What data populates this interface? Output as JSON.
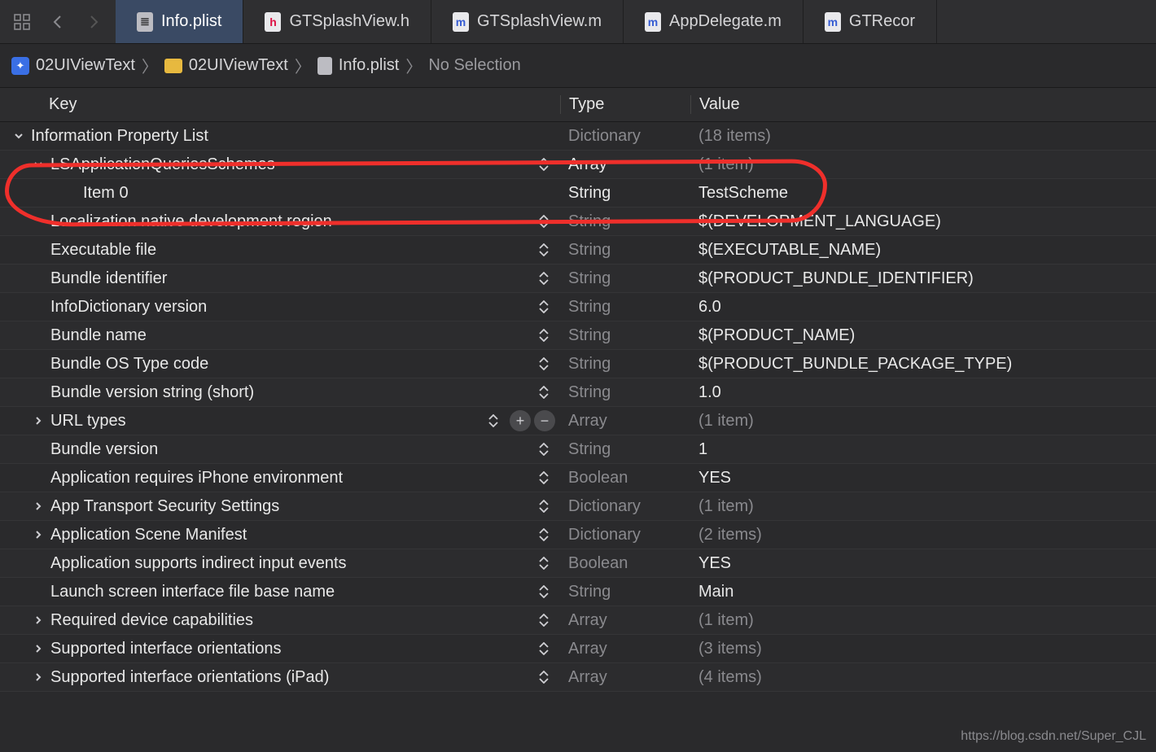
{
  "tabs": {
    "active": "Info.plist",
    "items": [
      {
        "label": "Info.plist",
        "icon": "plist"
      },
      {
        "label": "GTSplashView.h",
        "icon": "h"
      },
      {
        "label": "GTSplashView.m",
        "icon": "m"
      },
      {
        "label": "AppDelegate.m",
        "icon": "m"
      },
      {
        "label": "GTRecor",
        "icon": "m"
      }
    ]
  },
  "breadcrumb": {
    "project": "02UIViewText",
    "folder": "02UIViewText",
    "file": "Info.plist",
    "selection": "No Selection"
  },
  "columns": {
    "key": "Key",
    "type": "Type",
    "value": "Value"
  },
  "rows": [
    {
      "key": "Information Property List",
      "type": "Dictionary",
      "value": "(18 items)",
      "indent": 0,
      "disclosure": "down",
      "typeActive": false,
      "valueMuted": true,
      "stepper": false,
      "plusminus": false
    },
    {
      "key": "LSApplicationQueriesSchemes",
      "type": "Array",
      "value": "(1 item)",
      "indent": 1,
      "disclosure": "down",
      "typeActive": true,
      "valueMuted": true,
      "stepper": true,
      "plusminus": false
    },
    {
      "key": "Item 0",
      "type": "String",
      "value": "TestScheme",
      "indent": 2,
      "disclosure": "none",
      "typeActive": true,
      "valueMuted": false,
      "stepper": false,
      "plusminus": false
    },
    {
      "key": "Localization native development region",
      "type": "String",
      "value": "$(DEVELOPMENT_LANGUAGE)",
      "indent": 1,
      "disclosure": "none",
      "typeActive": false,
      "valueMuted": false,
      "stepper": true,
      "plusminus": false
    },
    {
      "key": "Executable file",
      "type": "String",
      "value": "$(EXECUTABLE_NAME)",
      "indent": 1,
      "disclosure": "none",
      "typeActive": false,
      "valueMuted": false,
      "stepper": true,
      "plusminus": false
    },
    {
      "key": "Bundle identifier",
      "type": "String",
      "value": "$(PRODUCT_BUNDLE_IDENTIFIER)",
      "indent": 1,
      "disclosure": "none",
      "typeActive": false,
      "valueMuted": false,
      "stepper": true,
      "plusminus": false
    },
    {
      "key": "InfoDictionary version",
      "type": "String",
      "value": "6.0",
      "indent": 1,
      "disclosure": "none",
      "typeActive": false,
      "valueMuted": false,
      "stepper": true,
      "plusminus": false
    },
    {
      "key": "Bundle name",
      "type": "String",
      "value": "$(PRODUCT_NAME)",
      "indent": 1,
      "disclosure": "none",
      "typeActive": false,
      "valueMuted": false,
      "stepper": true,
      "plusminus": false
    },
    {
      "key": "Bundle OS Type code",
      "type": "String",
      "value": "$(PRODUCT_BUNDLE_PACKAGE_TYPE)",
      "indent": 1,
      "disclosure": "none",
      "typeActive": false,
      "valueMuted": false,
      "stepper": true,
      "plusminus": false
    },
    {
      "key": "Bundle version string (short)",
      "type": "String",
      "value": "1.0",
      "indent": 1,
      "disclosure": "none",
      "typeActive": false,
      "valueMuted": false,
      "stepper": true,
      "plusminus": false
    },
    {
      "key": "URL types",
      "type": "Array",
      "value": "(1 item)",
      "indent": 1,
      "disclosure": "right",
      "typeActive": false,
      "valueMuted": true,
      "stepper": false,
      "plusminus": true
    },
    {
      "key": "Bundle version",
      "type": "String",
      "value": "1",
      "indent": 1,
      "disclosure": "none",
      "typeActive": false,
      "valueMuted": false,
      "stepper": true,
      "plusminus": false
    },
    {
      "key": "Application requires iPhone environment",
      "type": "Boolean",
      "value": "YES",
      "indent": 1,
      "disclosure": "none",
      "typeActive": false,
      "valueMuted": false,
      "stepper": true,
      "plusminus": false
    },
    {
      "key": "App Transport Security Settings",
      "type": "Dictionary",
      "value": "(1 item)",
      "indent": 1,
      "disclosure": "right",
      "typeActive": false,
      "valueMuted": true,
      "stepper": true,
      "plusminus": false
    },
    {
      "key": "Application Scene Manifest",
      "type": "Dictionary",
      "value": "(2 items)",
      "indent": 1,
      "disclosure": "right",
      "typeActive": false,
      "valueMuted": true,
      "stepper": true,
      "plusminus": false
    },
    {
      "key": "Application supports indirect input events",
      "type": "Boolean",
      "value": "YES",
      "indent": 1,
      "disclosure": "none",
      "typeActive": false,
      "valueMuted": false,
      "stepper": true,
      "plusminus": false
    },
    {
      "key": "Launch screen interface file base name",
      "type": "String",
      "value": "Main",
      "indent": 1,
      "disclosure": "none",
      "typeActive": false,
      "valueMuted": false,
      "stepper": true,
      "plusminus": false
    },
    {
      "key": "Required device capabilities",
      "type": "Array",
      "value": "(1 item)",
      "indent": 1,
      "disclosure": "right",
      "typeActive": false,
      "valueMuted": true,
      "stepper": true,
      "plusminus": false
    },
    {
      "key": "Supported interface orientations",
      "type": "Array",
      "value": "(3 items)",
      "indent": 1,
      "disclosure": "right",
      "typeActive": false,
      "valueMuted": true,
      "stepper": true,
      "plusminus": false
    },
    {
      "key": "Supported interface orientations (iPad)",
      "type": "Array",
      "value": "(4 items)",
      "indent": 1,
      "disclosure": "right",
      "typeActive": false,
      "valueMuted": true,
      "stepper": true,
      "plusminus": false
    }
  ],
  "watermark": "https://blog.csdn.net/Super_CJL"
}
